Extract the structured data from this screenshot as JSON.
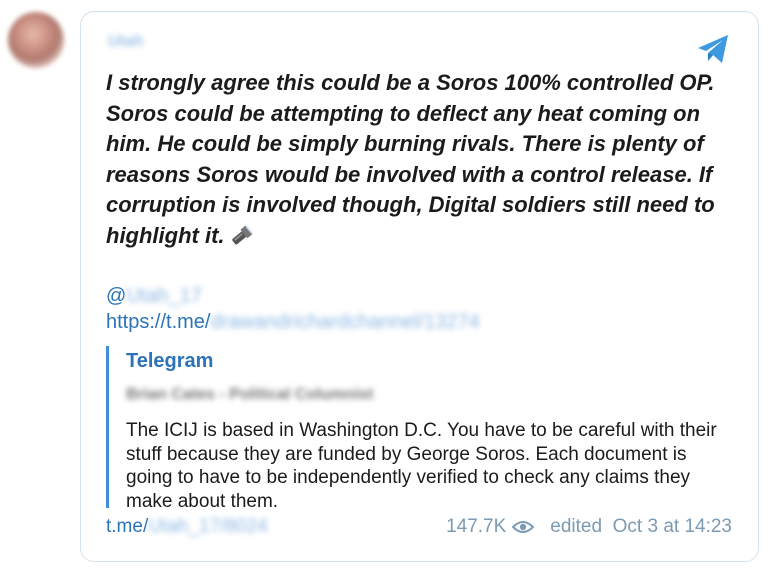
{
  "author": {
    "name": "Utah"
  },
  "message": {
    "text": "I strongly agree this could be a Soros 100% controlled OP.\nSoros could be attempting to deflect any heat coming on\nhim. He could be simply burning rivals. There is plenty of\nreasons Soros would be involved with a control release. If\ncorruption is involved though, Digital soldiers still need to\nhighlight it.",
    "mention_prefix": "@",
    "mention_handle": "Utah_17",
    "link_prefix": "https://t.me/",
    "link_path": "drawandrichardchannel/13274"
  },
  "preview": {
    "site": "Telegram",
    "title": "Brian Cates - Political Columnist",
    "description": "The ICIJ is based in Washington D.C. You have to be careful with their stuff because they are funded by George Soros. Each document is going to have to be independently verified to check any claims they make about them."
  },
  "footer": {
    "link_prefix": "t.me/",
    "link_path": "Utah_17/8024",
    "views": "147.7K",
    "edited_label": "edited",
    "timestamp": "Oct 3 at 14:23"
  },
  "icons": {
    "brand": "telegram-plane-icon",
    "emoji": "flashlight-icon",
    "views": "eye-icon"
  },
  "colors": {
    "link": "#2c73b8",
    "accent": "#3f8fd6",
    "meta": "#7c9ab4",
    "border": "#d5e2ee"
  }
}
